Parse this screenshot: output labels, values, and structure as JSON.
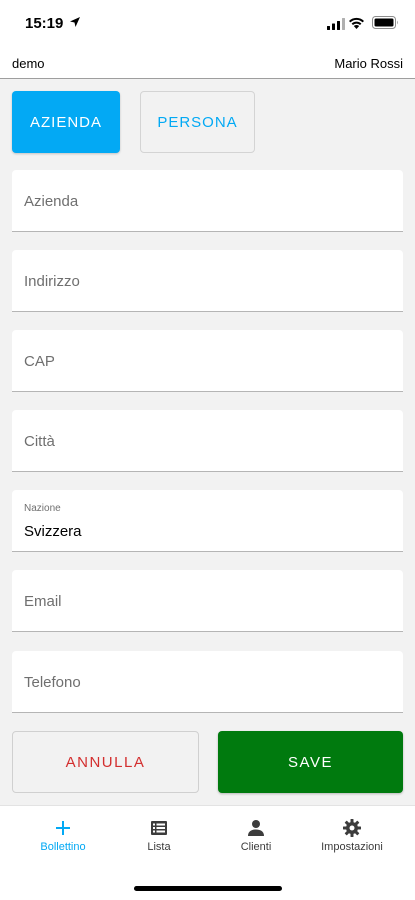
{
  "status_bar": {
    "time": "15:19"
  },
  "header": {
    "workspace": "demo",
    "user": "Mario Rossi"
  },
  "type_toggle": {
    "azienda_label": "AZIENDA",
    "persona_label": "PERSONA",
    "selected": "AZIENDA"
  },
  "form": {
    "azienda_placeholder": "Azienda",
    "indirizzo_placeholder": "Indirizzo",
    "cap_placeholder": "CAP",
    "citta_placeholder": "Città",
    "nazione_label": "Nazione",
    "nazione_value": "Svizzera",
    "email_placeholder": "Email",
    "telefono_placeholder": "Telefono"
  },
  "actions": {
    "cancel_label": "ANNULLA",
    "save_label": "SAVE"
  },
  "nav": {
    "items": [
      {
        "label": "Bollettino",
        "icon": "plus-icon",
        "active": true
      },
      {
        "label": "Lista",
        "icon": "list-icon",
        "active": false
      },
      {
        "label": "Clienti",
        "icon": "person-icon",
        "active": false
      },
      {
        "label": "Impostazioni",
        "icon": "gear-icon",
        "active": false
      }
    ]
  },
  "colors": {
    "accent": "#03a9f4",
    "save": "#007a0e",
    "cancel_text": "#d32f2f"
  }
}
